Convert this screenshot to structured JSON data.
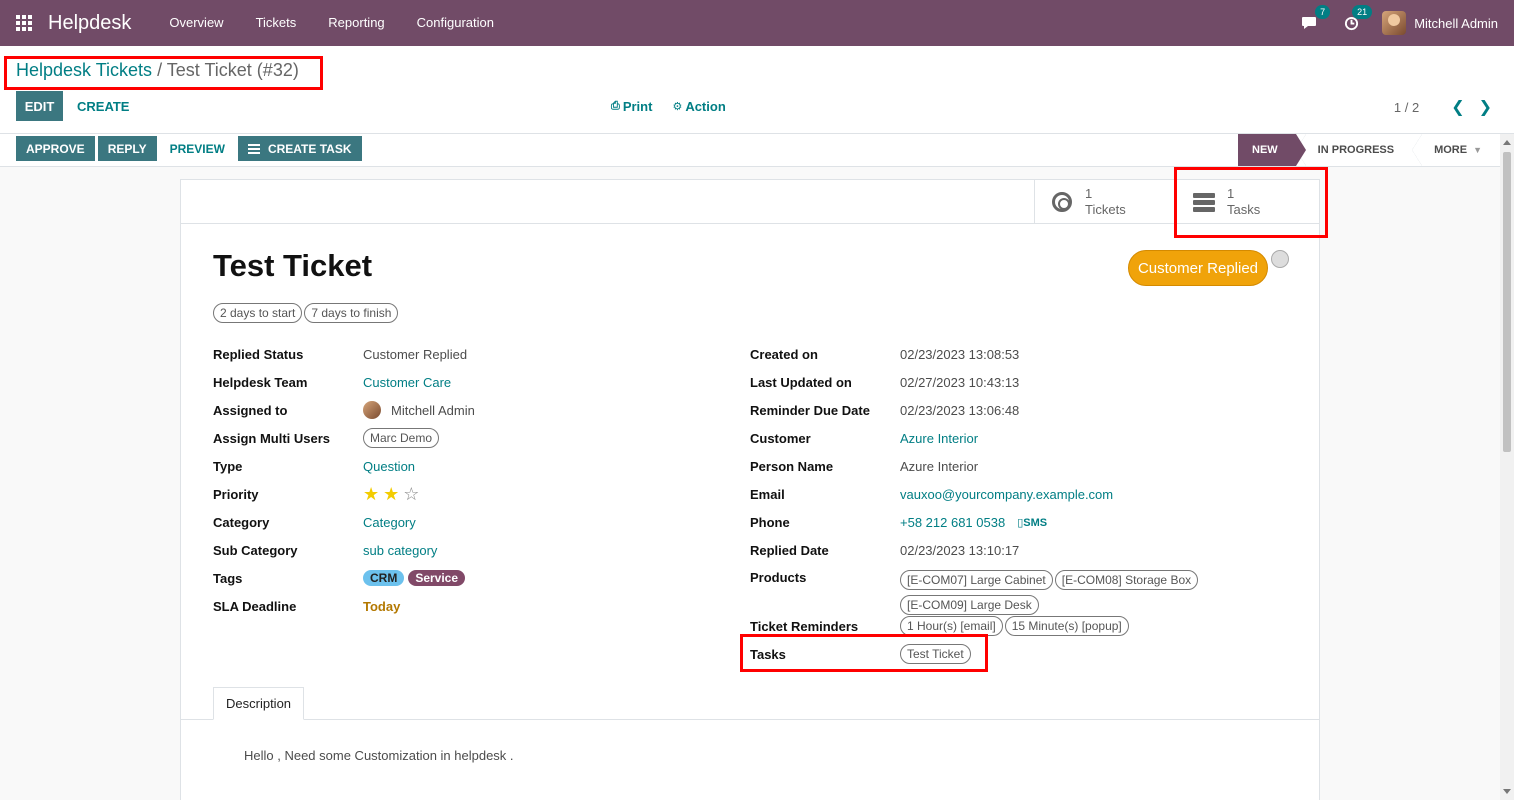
{
  "navbar": {
    "app_name": "Helpdesk",
    "menu": [
      "Overview",
      "Tickets",
      "Reporting",
      "Configuration"
    ],
    "messages_count": "7",
    "activities_count": "21",
    "user_name": "Mitchell Admin",
    "bg_color": "#714b67"
  },
  "breadcrumb": {
    "parent": "Helpdesk Tickets",
    "separator": "/",
    "current": "Test Ticket (#32)"
  },
  "control_panel": {
    "edit_label": "EDIT",
    "create_label": "CREATE",
    "print_label": "Print",
    "action_label": "Action",
    "pager_value": "1 / 2"
  },
  "statusbar": {
    "approve_label": "APPROVE",
    "reply_label": "REPLY",
    "preview_label": "PREVIEW",
    "create_task_label": "CREATE TASK",
    "stages": [
      "NEW",
      "IN PROGRESS",
      "MORE"
    ],
    "active_stage": "NEW"
  },
  "smart_buttons": {
    "tickets": {
      "count": "1",
      "label": "Tickets",
      "icon": "life-ring-icon"
    },
    "tasks": {
      "count": "1",
      "label": "Tasks",
      "icon": "server-icon"
    }
  },
  "ticket": {
    "title": "Test Ticket",
    "replied_badge": "Customer Replied",
    "chips": [
      "2 days to start",
      "7 days to finish"
    ],
    "left_fields": {
      "replied_status": {
        "label": "Replied Status",
        "value": "Customer Replied"
      },
      "helpdesk_team": {
        "label": "Helpdesk Team",
        "value": "Customer Care"
      },
      "assigned_to": {
        "label": "Assigned to",
        "value": "Mitchell Admin"
      },
      "assign_multi_users": {
        "label": "Assign Multi Users",
        "value": "Marc Demo"
      },
      "type": {
        "label": "Type",
        "value": "Question"
      },
      "priority": {
        "label": "Priority",
        "stars_filled": 2,
        "stars_total": 3,
        "star_on": "★",
        "star_off": "☆"
      },
      "category": {
        "label": "Category",
        "value": "Category"
      },
      "sub_category": {
        "label": "Sub Category",
        "value": "sub category"
      },
      "tags": {
        "label": "Tags",
        "values": [
          "CRM",
          "Service"
        ]
      },
      "sla_deadline": {
        "label": "SLA Deadline",
        "value": "Today"
      }
    },
    "right_fields": {
      "created_on": {
        "label": "Created on",
        "value": "02/23/2023 13:08:53"
      },
      "last_updated_on": {
        "label": "Last Updated on",
        "value": "02/27/2023 10:43:13"
      },
      "reminder_due_date": {
        "label": "Reminder Due Date",
        "value": "02/23/2023 13:06:48"
      },
      "customer": {
        "label": "Customer",
        "value": "Azure Interior"
      },
      "person_name": {
        "label": "Person Name",
        "value": "Azure Interior"
      },
      "email": {
        "label": "Email",
        "value": "vauxoo@yourcompany.example.com"
      },
      "phone": {
        "label": "Phone",
        "value": "+58 212 681 0538",
        "sms": "SMS"
      },
      "replied_date": {
        "label": "Replied Date",
        "value": "02/23/2023 13:10:17"
      },
      "products": {
        "label": "Products",
        "values": [
          "[E-COM07] Large Cabinet",
          "[E-COM08] Storage Box",
          "[E-COM09] Large Desk"
        ]
      },
      "ticket_reminders": {
        "label": "Ticket Reminders",
        "values": [
          "1 Hour(s) [email]",
          "15 Minute(s) [popup]"
        ]
      },
      "tasks": {
        "label": "Tasks",
        "values": [
          "Test Ticket"
        ]
      }
    },
    "notebook_tab": "Description",
    "description": "Hello , Need some Customization in helpdesk ."
  },
  "colors": {
    "primary": "#714b67",
    "accent": "#017e84",
    "button": "#3b7780",
    "highlight_box": "#ff0000",
    "badge_orange": "#f0a30a"
  }
}
